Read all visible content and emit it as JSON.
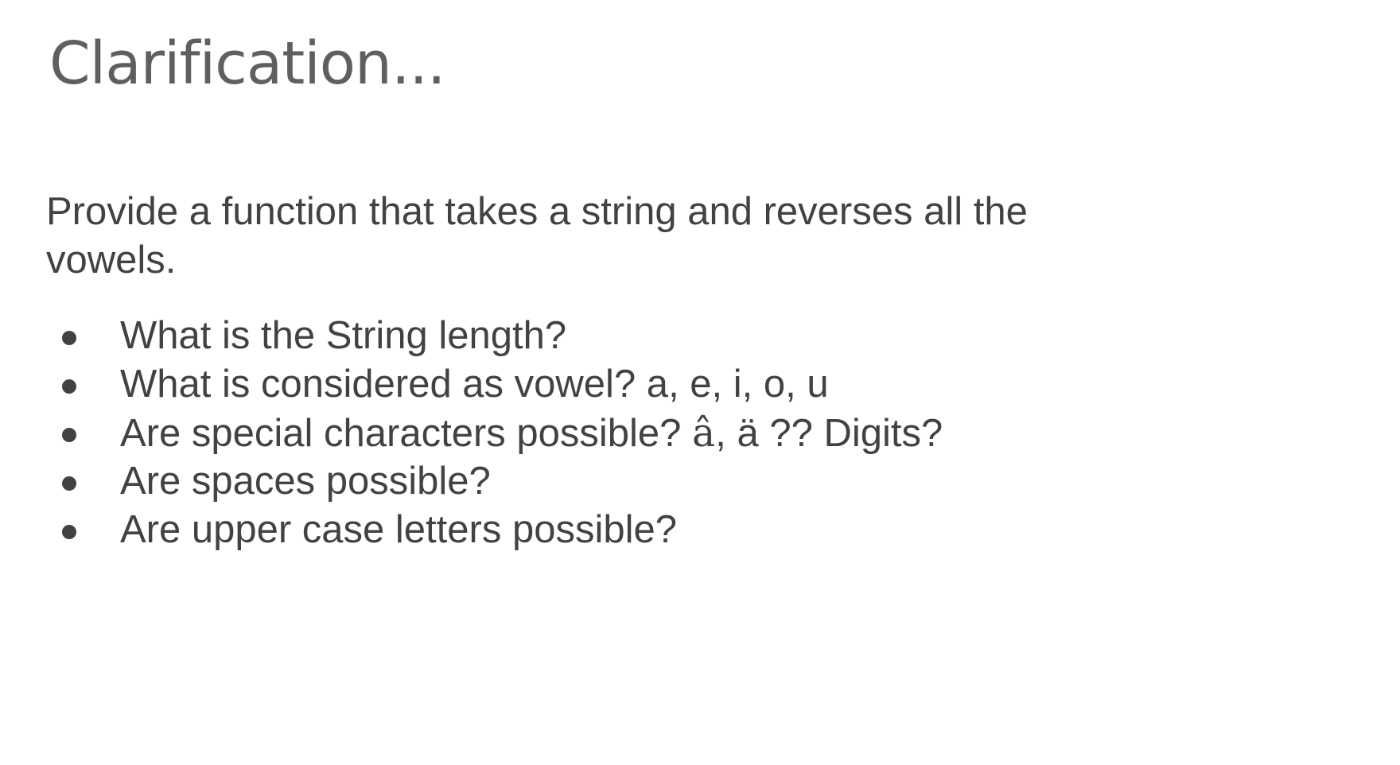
{
  "slide": {
    "title": "Clarification...",
    "intro": "Provide a function that takes a string and reverses all the vowels.",
    "bullets": [
      {
        "text": "What is the String length?"
      },
      {
        "text": "What is considered as vowel? a, e, i, o, u"
      },
      {
        "text_before": "Are special characters possible? ",
        "special": "â",
        "text_after": ", ä ?? Digits?"
      },
      {
        "text": "Are spaces possible?"
      },
      {
        "text": "Are upper case letters possible?"
      }
    ]
  },
  "colors": {
    "background": "#ffffff",
    "title": "#5f5f5f",
    "body_text": "#424242"
  }
}
